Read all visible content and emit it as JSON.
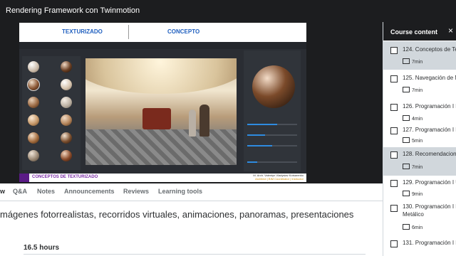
{
  "window": {
    "title": "Rendering Framework con Twinmotion"
  },
  "slide": {
    "tab_left": "TEXTURIZADO",
    "tab_right": "CONCEPTO",
    "footer_title": "CONCEPTOS DE TEXTURIZADO",
    "footer_author": "M. Arch. Valentyn Vladyslav Kotsarenko",
    "footer_role": "Architect | BIM Coordinator | Instructor"
  },
  "tabs": [
    "w",
    "Q&A",
    "Notes",
    "Announcements",
    "Reviews",
    "Learning tools"
  ],
  "description": "mágenes fotorrealistas, recorridos virtuales, animaciones, panoramas, presentaciones",
  "course_length": "16.5 hours",
  "sidebar": {
    "header": "Course content",
    "items": [
      {
        "title": "124. Conceptos de Te",
        "duration": "7min",
        "active": true
      },
      {
        "title": "125. Navegación de M",
        "duration": "7min",
        "active": false
      },
      {
        "title": "126. Programación I B",
        "duration": "4min",
        "active": false
      },
      {
        "title": "127. Programación I B",
        "duration": "5min",
        "active": false
      },
      {
        "title": "128. Recomendacione",
        "duration": "7min",
        "active": true
      },
      {
        "title": "129. Programación I U",
        "duration": "9min",
        "active": false
      },
      {
        "title": "130. Programación I R",
        "title2": "Metálico",
        "duration": "6min",
        "active": false
      },
      {
        "title": "131. Programación I N",
        "duration": "",
        "active": false
      }
    ]
  },
  "colors": {
    "topbar": "#1c1d1f",
    "accent_purple": "#5a1b86",
    "slide_blue": "#1f5fbf"
  }
}
